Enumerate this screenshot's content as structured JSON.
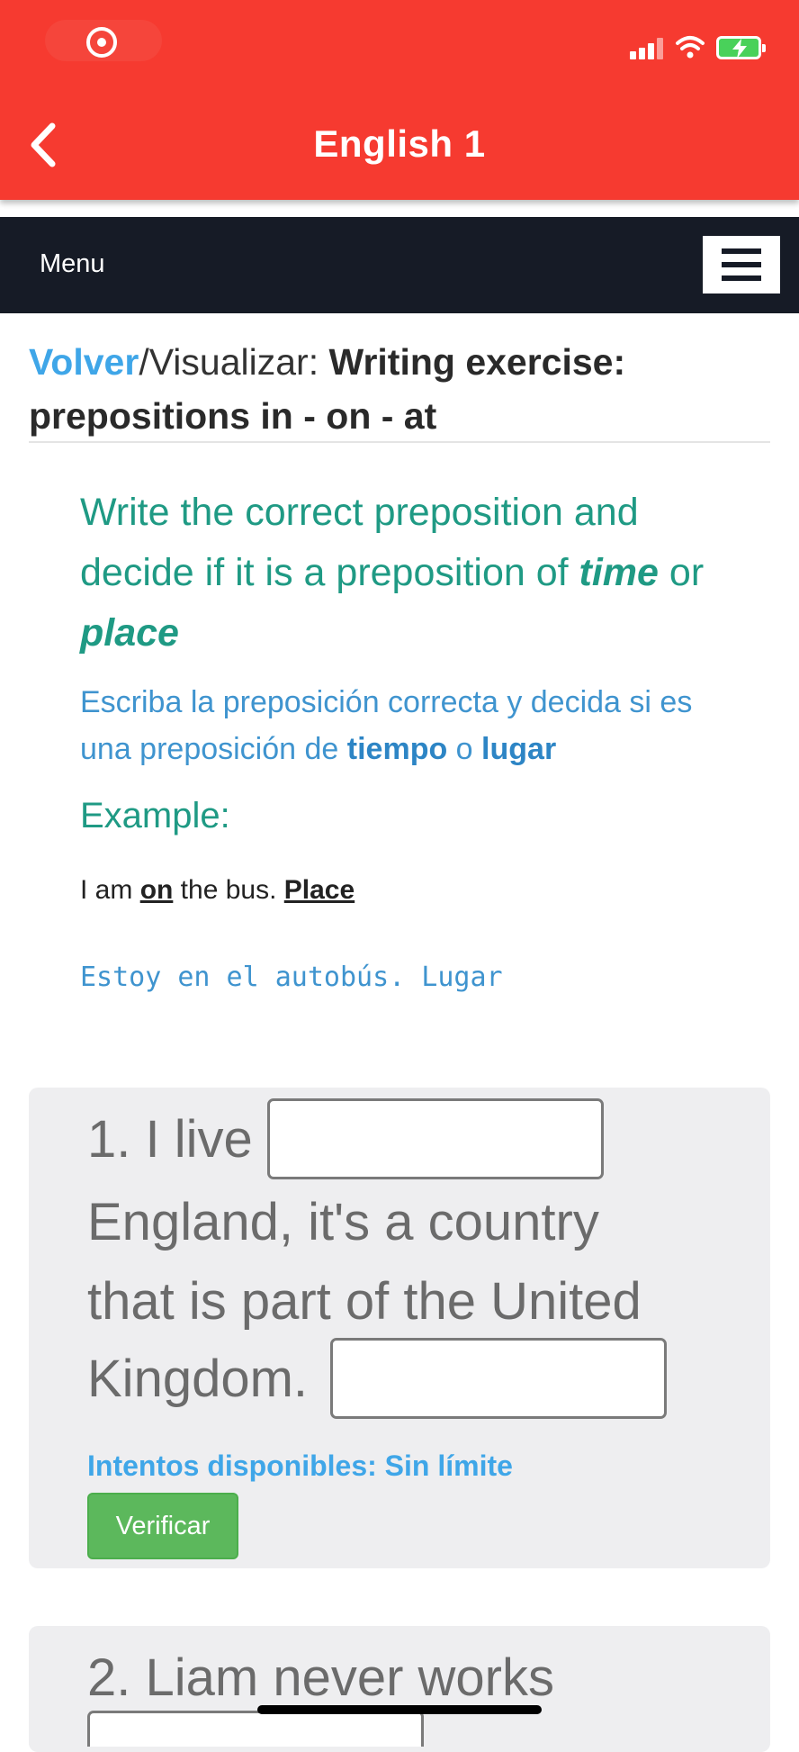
{
  "header": {
    "title": "English 1",
    "color": "#f63a30"
  },
  "status_bar": {
    "icons": [
      "screen-record-icon",
      "cellular-signal-icon",
      "wifi-icon",
      "battery-charging-icon"
    ]
  },
  "menubar": {
    "label": "Menu"
  },
  "breadcrumb": {
    "back_link": "Volver",
    "separator": "/Visualizar: ",
    "title": "Writing exercise: prepositions in - on - at"
  },
  "instructions": {
    "en_prefix": "Write the correct preposition and decide if it is a preposition of ",
    "en_time": "time",
    "en_or": " or ",
    "en_place": "place",
    "es_prefix": "Escriba la preposición correcta y decida si es una preposición de ",
    "es_tiempo": "tiempo",
    "es_o": " o ",
    "es_lugar": "lugar"
  },
  "example": {
    "heading": "Example:",
    "en_part1": "I am ",
    "en_prep": "on",
    "en_part2": " the bus. ",
    "en_type": "Place",
    "es_sentence": "Estoy en el autobús. Lugar"
  },
  "questions": [
    {
      "line1": "1. I live",
      "line2": "England, it's a country",
      "line3": "that is part of the United",
      "line4": "Kingdom.",
      "input1_value": "",
      "input2_value": "",
      "attempts": "Intentos disponibles: Sin límite",
      "verify_label": "Verificar"
    },
    {
      "line1": "2. Liam never works"
    }
  ]
}
